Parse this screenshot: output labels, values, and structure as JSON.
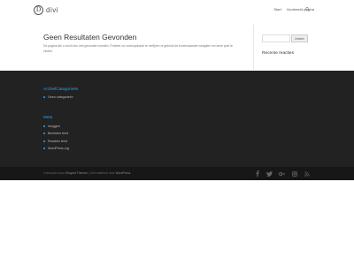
{
  "header": {
    "logo_text": "divi",
    "logo_letter": "D",
    "nav": [
      "Start",
      "Voorbeeld pagina"
    ]
  },
  "main": {
    "title": "Geen Resultaten Gevonden",
    "text": "De pagina die u zocht kon niet gevonden worden. Probeer uw zoekopdracht te verfijnen of gebruik de bovenstaande navigatie om deze post te vinden."
  },
  "sidebar": {
    "search_button": "Zoeken",
    "search_placeholder": "",
    "recent_comments_title": "Recente reacties"
  },
  "footer": {
    "archives_title": "ArchiefCategorieën",
    "categories": [
      "Geen categorieën"
    ],
    "meta_title": "Meta",
    "meta_links": [
      "Inloggen",
      "Berichten feed",
      "Reacties feed",
      "WordPress.org"
    ],
    "credits_prefix": "Ontworpen door",
    "credits_theme": "Elegant Themes",
    "credits_separator": "|",
    "credits_middle": "Geïnstalleerd door",
    "credits_platform": "WordPress"
  },
  "colors": {
    "accent": "#2ea3f2",
    "footer_bg": "#222222",
    "footer_bottom_bg": "#171717",
    "social_icon": "#666666"
  },
  "icons": {
    "social": [
      "facebook-icon",
      "twitter-icon",
      "google-plus-icon",
      "instagram-icon",
      "rss-icon"
    ],
    "search": "search-icon"
  }
}
